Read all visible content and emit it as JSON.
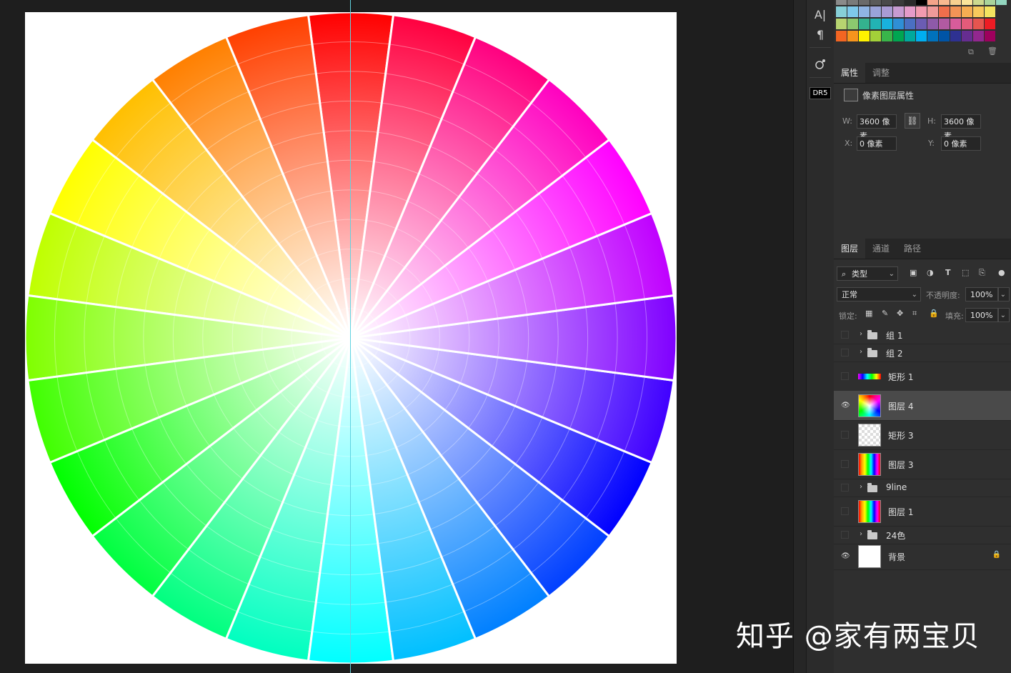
{
  "colors": {
    "canvas_bg": "#1e1e1e",
    "document_bg": "#ffffff",
    "guide": "#5fd3e0",
    "panel_bg": "#2f2f2f",
    "active_layer_bg": "#4a4a4a"
  },
  "tools": {
    "items": [
      {
        "name": "character-icon",
        "glyph": "A|"
      },
      {
        "name": "paragraph-icon",
        "glyph": "¶"
      },
      {
        "name": "share-icon",
        "glyph": "⚙"
      },
      {
        "name": "plugin-icon",
        "glyph": "DR5"
      }
    ]
  },
  "swatches": {
    "row1": [
      "#8a8a8a",
      "#7a7a7a",
      "#6a6a6a",
      "#5a5a5a",
      "#4a4a4a",
      "#3a3a3a",
      "#2a2a2a",
      "#000000",
      "#f4a48a",
      "#f7b88f",
      "#f8d090",
      "#f9e49a",
      "#ccd98f",
      "#a9d49b",
      "#93d6bf"
    ],
    "row2": [
      "#87cfd7",
      "#7ec8ea",
      "#8fb4e3",
      "#9aa3d9",
      "#a99bd3",
      "#c79bd1",
      "#e59bc9",
      "#f29bb0",
      "#f09a9a",
      "#ef6f4c",
      "#f39456",
      "#f6ad52",
      "#f7c95c",
      "#f3e360"
    ],
    "row3": [
      "#b7d470",
      "#8cc86f",
      "#34b28e",
      "#22b3b4",
      "#19b1df",
      "#2f8fd6",
      "#4a6fc2",
      "#6b5cb3",
      "#8e5aa8",
      "#b25aa2",
      "#d85c9b",
      "#e45b7a",
      "#e5554f",
      "#ed1c24"
    ],
    "row4": [
      "#f26522",
      "#f7941d",
      "#fff200",
      "#a3d039",
      "#39b54a",
      "#00a651",
      "#00a99d",
      "#00aeef",
      "#0072bc",
      "#0054a6",
      "#2e3192",
      "#662d91",
      "#92278f",
      "#9e005d"
    ]
  },
  "properties_panel": {
    "tabs": [
      "属性",
      "调整"
    ],
    "title": "像素图层属性",
    "w_label": "W:",
    "w_value": "3600 像素",
    "h_label": "H:",
    "h_value": "3600 像素",
    "x_label": "X:",
    "x_value": "0 像素",
    "y_label": "Y:",
    "y_value": "0 像素"
  },
  "layers_panel": {
    "tabs": [
      "图层",
      "通道",
      "路径"
    ],
    "filter_label": "类型",
    "blend_mode": "正常",
    "opacity_label": "不透明度:",
    "opacity_value": "100%",
    "lock_label": "锁定:",
    "fill_label": "填充:",
    "fill_value": "100%",
    "layers": [
      {
        "name": "组 1",
        "type": "group",
        "visible": false
      },
      {
        "name": "组 2",
        "type": "group",
        "visible": false
      },
      {
        "name": "矩形 1",
        "type": "shape-small",
        "visible": false
      },
      {
        "name": "图层 4",
        "type": "wheel",
        "visible": true,
        "active": true
      },
      {
        "name": "矩形 3",
        "type": "checker",
        "visible": false
      },
      {
        "name": "图层 3",
        "type": "rainbow",
        "visible": false
      },
      {
        "name": "9line",
        "type": "group",
        "visible": false
      },
      {
        "name": "图层 1",
        "type": "rainbow",
        "visible": false
      },
      {
        "name": "24色",
        "type": "group",
        "visible": false
      },
      {
        "name": "背景",
        "type": "white",
        "visible": true,
        "locked": true
      }
    ]
  },
  "watermark": "知乎 @家有两宝贝"
}
